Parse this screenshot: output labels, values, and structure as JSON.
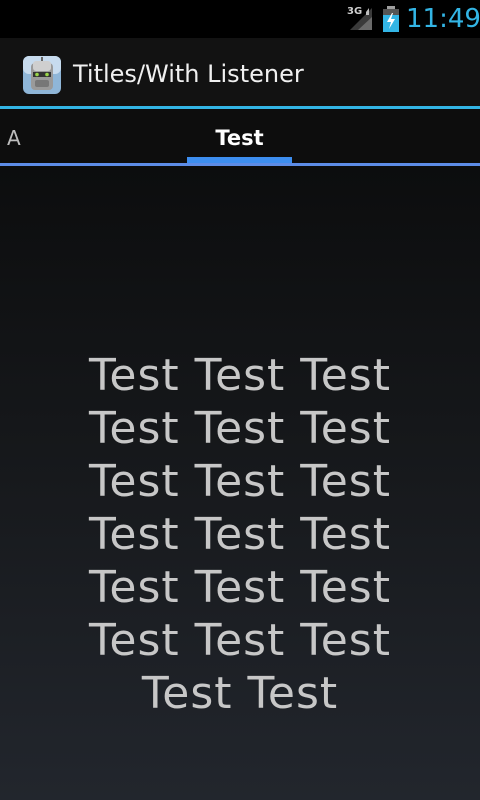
{
  "status_bar": {
    "network": "3G",
    "time": "11:49",
    "icons": [
      "signal-icon",
      "battery-charging-icon"
    ]
  },
  "action_bar": {
    "icon": "robot-app-icon",
    "title": "Titles/With Listener"
  },
  "tabs": [
    {
      "label": "A",
      "selected": false
    },
    {
      "label": "Test",
      "selected": true
    }
  ],
  "content": {
    "text": "Test Test Test Test Test Test Test Test Test Test Test Test Test Test Test Test Test Test Test Test"
  },
  "colors": {
    "accent": "#33b5e5",
    "tab_indicator": "#3d8ef0",
    "background": "#000000",
    "text": "#c7c7c7"
  }
}
